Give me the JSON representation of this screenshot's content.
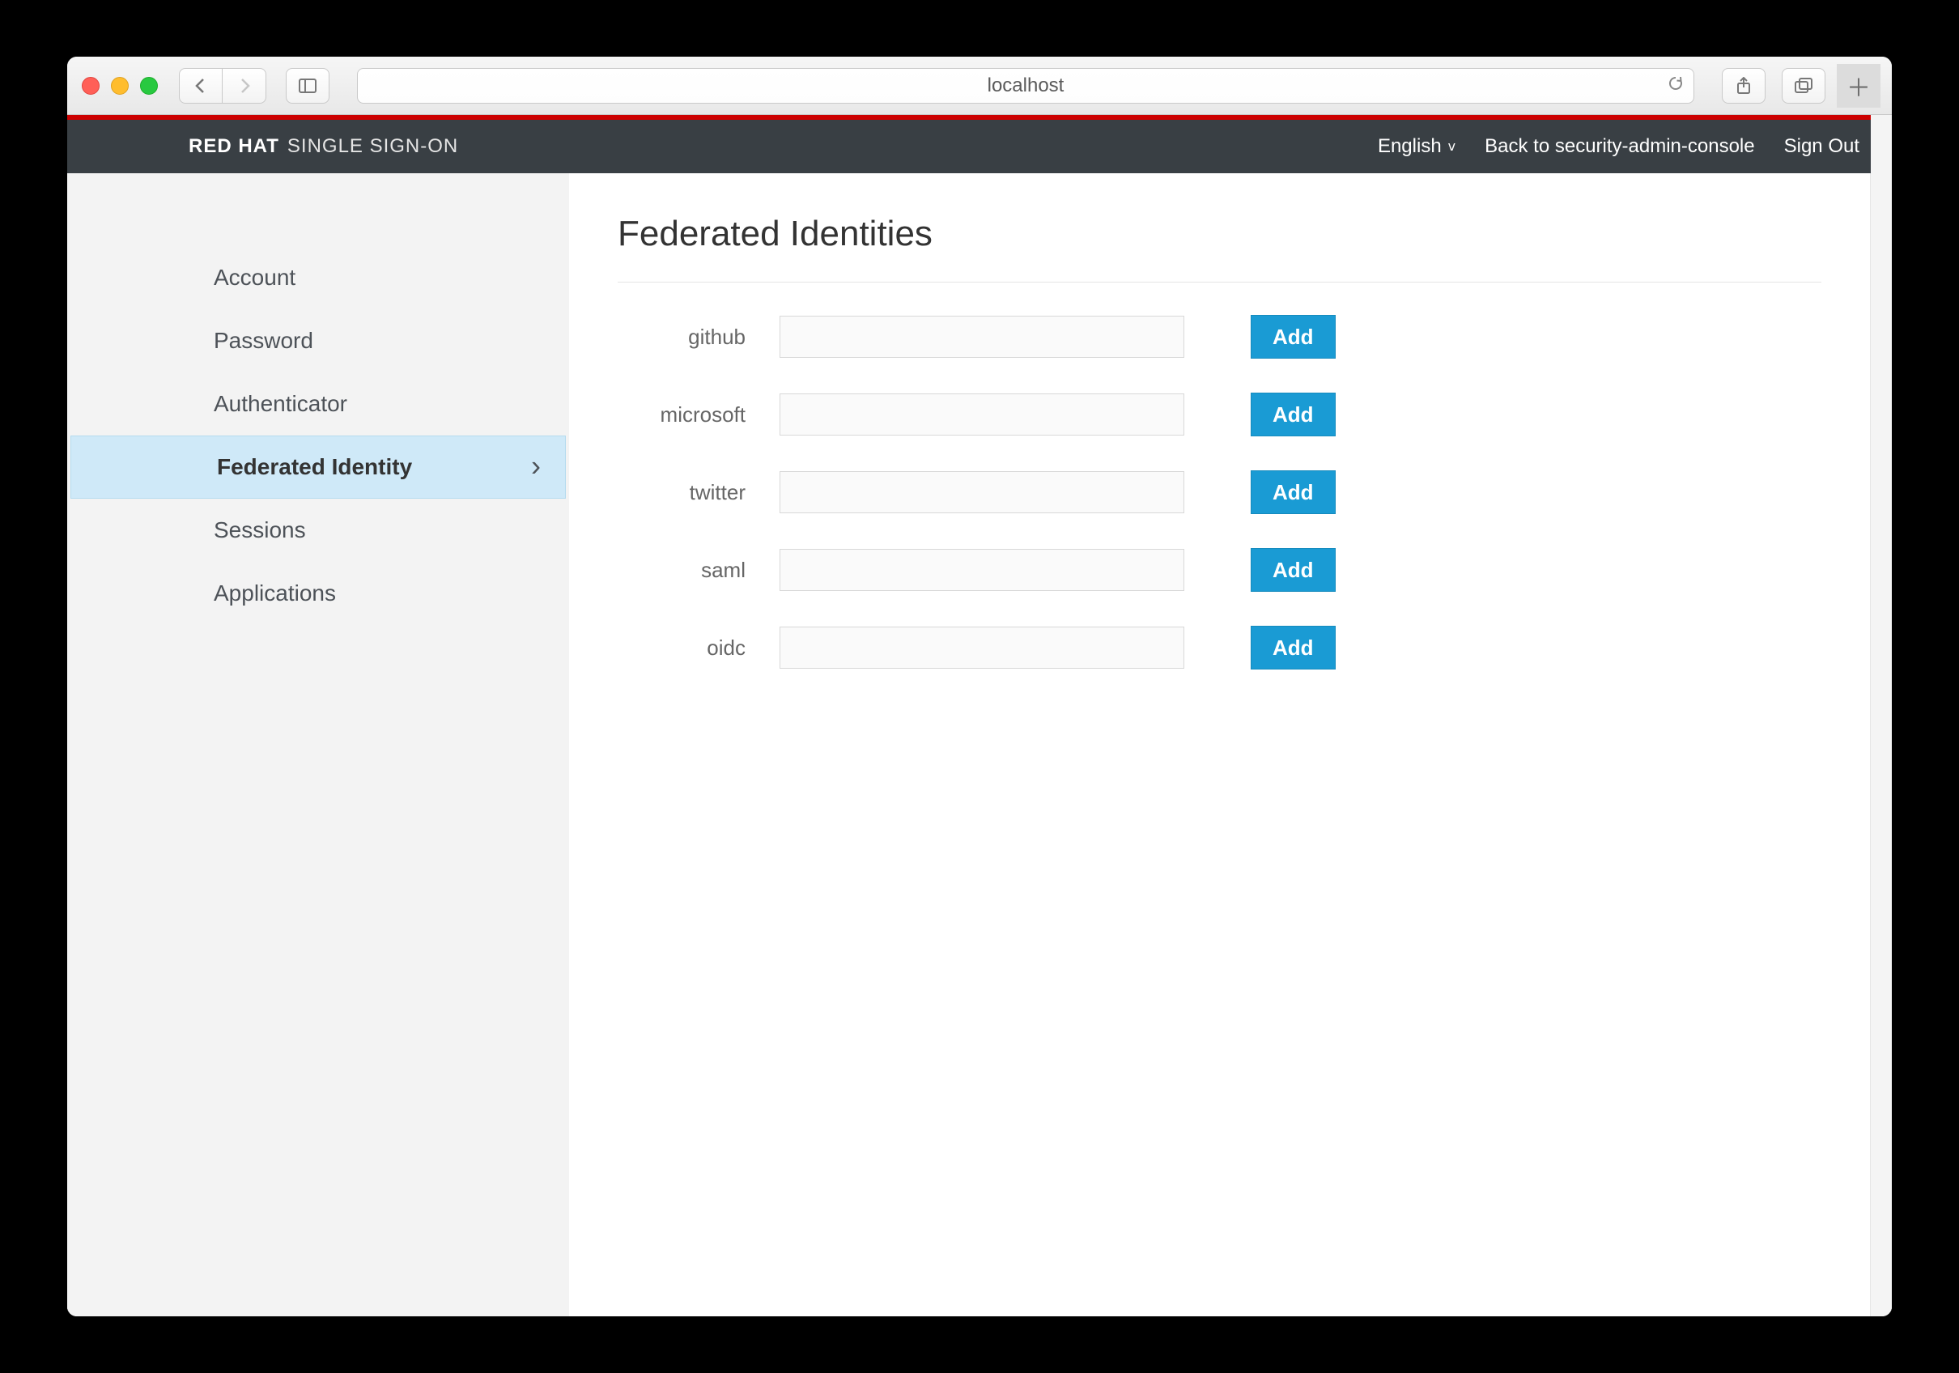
{
  "browser": {
    "address": "localhost"
  },
  "brand": {
    "primary": "RED HAT",
    "secondary": "SINGLE SIGN-ON"
  },
  "header": {
    "language_label": "English",
    "back_link": "Back to security-admin-console",
    "sign_out": "Sign Out"
  },
  "sidebar": {
    "items": [
      {
        "label": "Account",
        "active": false
      },
      {
        "label": "Password",
        "active": false
      },
      {
        "label": "Authenticator",
        "active": false
      },
      {
        "label": "Federated Identity",
        "active": true
      },
      {
        "label": "Sessions",
        "active": false
      },
      {
        "label": "Applications",
        "active": false
      }
    ]
  },
  "page": {
    "title": "Federated Identities",
    "add_label": "Add",
    "providers": [
      {
        "name": "github",
        "value": ""
      },
      {
        "name": "microsoft",
        "value": ""
      },
      {
        "name": "twitter",
        "value": ""
      },
      {
        "name": "saml",
        "value": ""
      },
      {
        "name": "oidc",
        "value": ""
      }
    ]
  }
}
